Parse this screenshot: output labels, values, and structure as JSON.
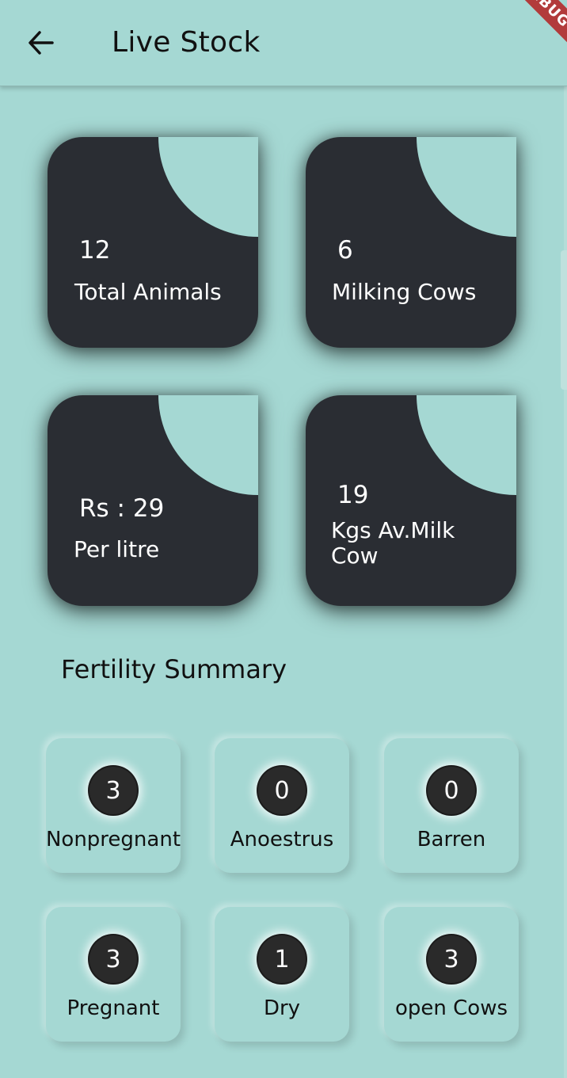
{
  "appbar": {
    "title": "Live Stock",
    "back_icon": "arrow-left-icon",
    "debug_banner": "DEBUG"
  },
  "colors": {
    "background": "#a5d8d3",
    "card": "#2a2d33",
    "badge": "#2a2a2a",
    "banner": "#b23b3b"
  },
  "stats": [
    {
      "value": "12",
      "label": "Total Animals"
    },
    {
      "value": "6",
      "label": "Milking Cows"
    },
    {
      "value": "Rs : 29",
      "label": "Per litre"
    },
    {
      "value": "19",
      "label": "Kgs Av.Milk Cow"
    }
  ],
  "fertility": {
    "title": "Fertility Summary",
    "items": [
      {
        "count": "3",
        "label": "Nonpregnant"
      },
      {
        "count": "0",
        "label": "Anoestrus"
      },
      {
        "count": "0",
        "label": "Barren"
      },
      {
        "count": "3",
        "label": "Pregnant"
      },
      {
        "count": "1",
        "label": "Dry"
      },
      {
        "count": "3",
        "label": "open Cows"
      }
    ]
  }
}
